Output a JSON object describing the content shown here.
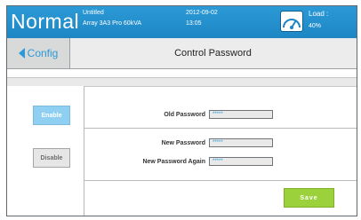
{
  "header": {
    "mode": "Normal",
    "file_name": "Untitled",
    "device": "Array 3A3 Pro 60kVA",
    "date": "2012-09-02",
    "time": "13:05",
    "load_label": "Load :",
    "load_value": "40%",
    "load_icon": "load-gauge-icon"
  },
  "nav": {
    "back_label": "Config",
    "title": "Control Password"
  },
  "side": {
    "enable_label": "Enable",
    "disable_label": "Disable"
  },
  "form": {
    "old_password_label": "Old Password",
    "old_password_value": "*****",
    "new_password_label": "New Password",
    "new_password_value": "*****",
    "new_password_again_label": "New Password Again",
    "new_password_again_value": "*****",
    "save_label": "Save"
  },
  "colors": {
    "accent": "#2b9ad6",
    "enable": "#8fd0f2",
    "save": "#9bd23b"
  }
}
